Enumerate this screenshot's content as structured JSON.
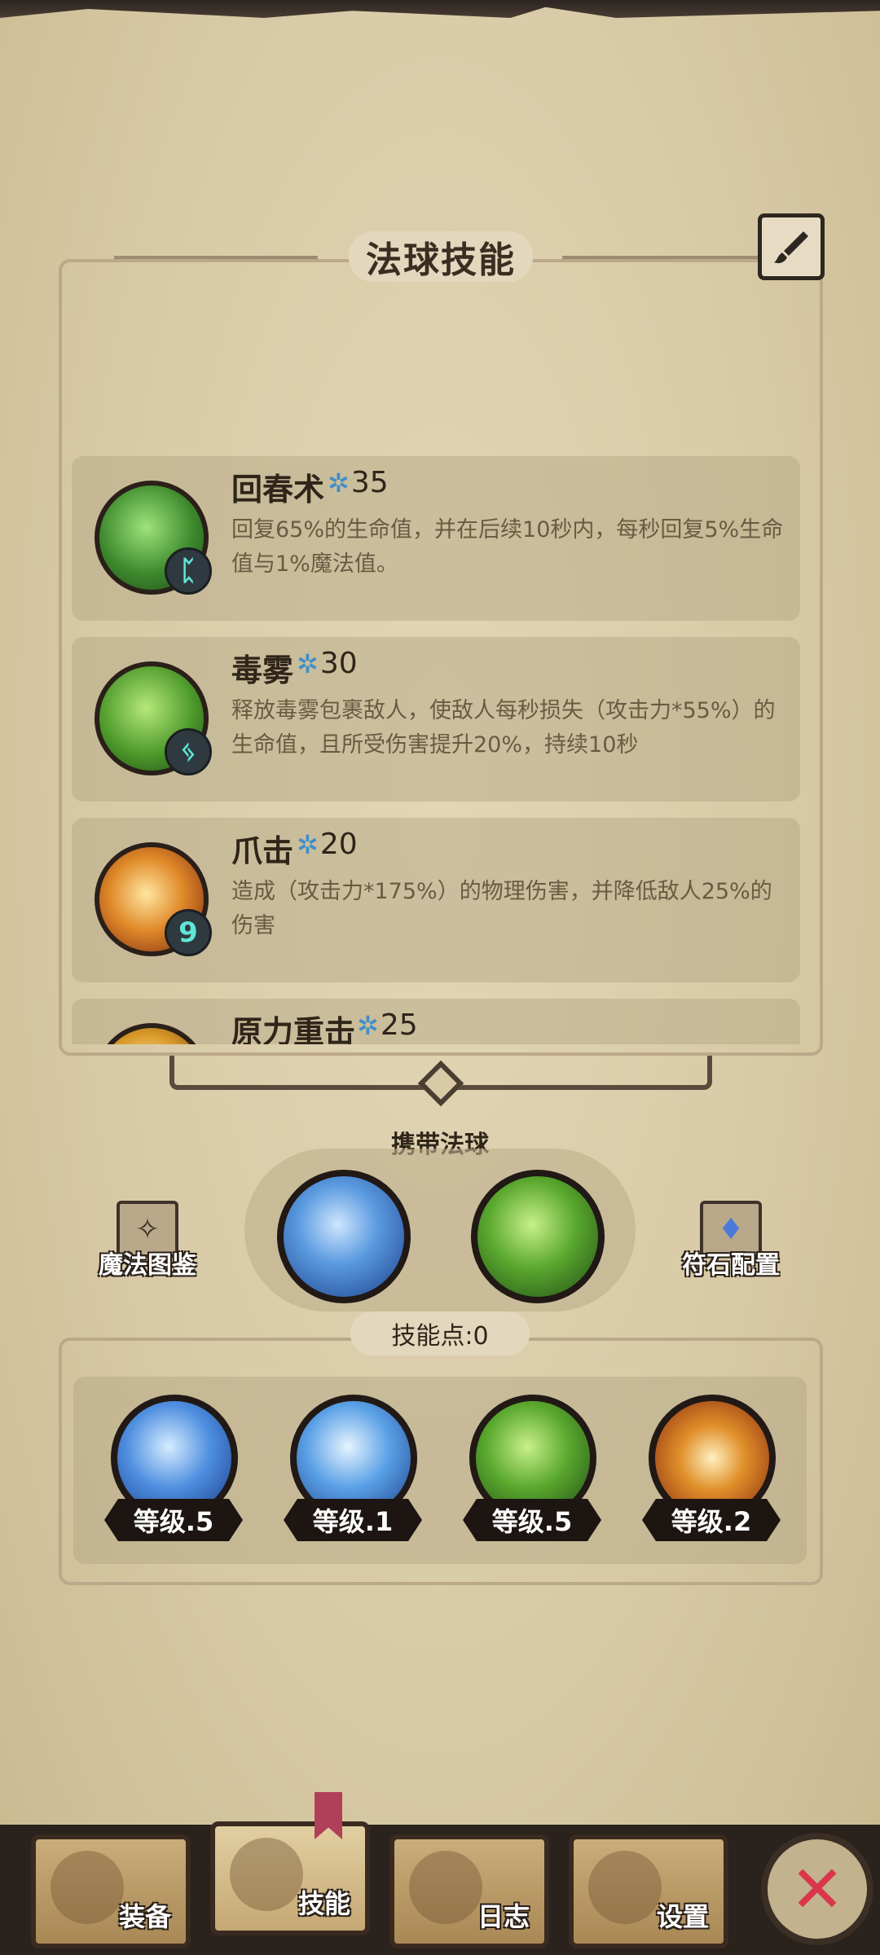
{
  "panel": {
    "title": "法球技能"
  },
  "skills": [
    {
      "name": "回春术",
      "cost": "35",
      "rune": "ᛈ",
      "description": "回复65%的生命值，并在后续10秒内，每秒回复5%生命值与1%魔法值。",
      "color": "#3d8a2e"
    },
    {
      "name": "毒雾",
      "cost": "30",
      "rune": "ᛃ",
      "description": "释放毒雾包裹敌人，使敌人每秒损失（攻击力*55%）的生命值，且所受伤害提升20%，持续10秒",
      "color": "#4d9a2b"
    },
    {
      "name": "爪击",
      "cost": "20",
      "rune": "9",
      "description": "造成（攻击力*175%）的物理伤害，并降低敌人25%的伤害",
      "color": "#c8621f"
    },
    {
      "name": "原力重击",
      "cost": "25",
      "rune": "",
      "description": "",
      "color": "#d99a2a"
    }
  ],
  "carry": {
    "label": "携带法球",
    "orbs": [
      {
        "name": "ice-orb",
        "color": "#2f6fc9"
      },
      {
        "name": "nature-orb",
        "color": "#4d9a2b"
      }
    ]
  },
  "side_buttons": {
    "left": "魔法图鉴",
    "right": "符石配置"
  },
  "skill_points": {
    "label": "技能点:0",
    "orbs": [
      {
        "name": "ice-crystal-orb",
        "level": "等级.5",
        "color": "#2f6fc9"
      },
      {
        "name": "frost-shatter-orb",
        "level": "等级.1",
        "color": "#3d7fc8"
      },
      {
        "name": "nature-orb",
        "level": "等级.5",
        "color": "#4d9a2b"
      },
      {
        "name": "fire-vortex-orb",
        "level": "等级.2",
        "color": "#d9741f"
      }
    ]
  },
  "nav": {
    "tabs": [
      "装备",
      "技能",
      "日志",
      "设置"
    ],
    "active": "技能"
  }
}
